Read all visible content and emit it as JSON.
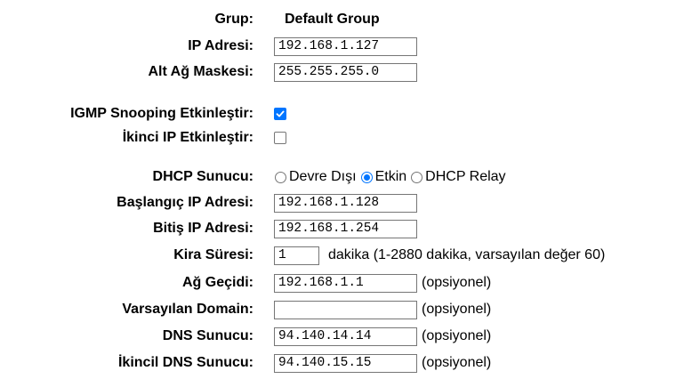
{
  "group": {
    "label": "Grup:",
    "value": "Default Group"
  },
  "ip_address": {
    "label": "IP Adresi:",
    "value": "192.168.1.127"
  },
  "subnet_mask": {
    "label": "Alt Ağ Maskesi:",
    "value": "255.255.255.0"
  },
  "igmp_snooping": {
    "label": "IGMP Snooping Etkinleştir:",
    "checked": true
  },
  "secondary_ip": {
    "label": "İkinci IP Etkinleştir:",
    "checked": false
  },
  "dhcp_server": {
    "label": "DHCP Sunucu:",
    "options": [
      {
        "label": "Devre Dışı",
        "checked": false
      },
      {
        "label": "Etkin",
        "checked": true
      },
      {
        "label": "DHCP Relay",
        "checked": false
      }
    ]
  },
  "start_ip": {
    "label": "Başlangıç IP Adresi:",
    "value": "192.168.1.128"
  },
  "end_ip": {
    "label": "Bitiş IP Adresi:",
    "value": "192.168.1.254"
  },
  "lease_time": {
    "label": "Kira Süresi:",
    "value": "1",
    "hint": "dakika (1-2880 dakika, varsayılan değer 60)"
  },
  "gateway": {
    "label": "Ağ Geçidi:",
    "value": "192.168.1.1",
    "hint": "(opsiyonel)"
  },
  "default_domain": {
    "label": "Varsayılan Domain:",
    "value": "",
    "hint": "(opsiyonel)"
  },
  "dns_server": {
    "label": "DNS Sunucu:",
    "value": "94.140.14.14",
    "hint": "(opsiyonel)"
  },
  "secondary_dns": {
    "label": "İkincil DNS Sunucu:",
    "value": "94.140.15.15",
    "hint": "(opsiyonel)"
  },
  "colors": {
    "accent": "#0075ff",
    "input_border": "#767676"
  }
}
